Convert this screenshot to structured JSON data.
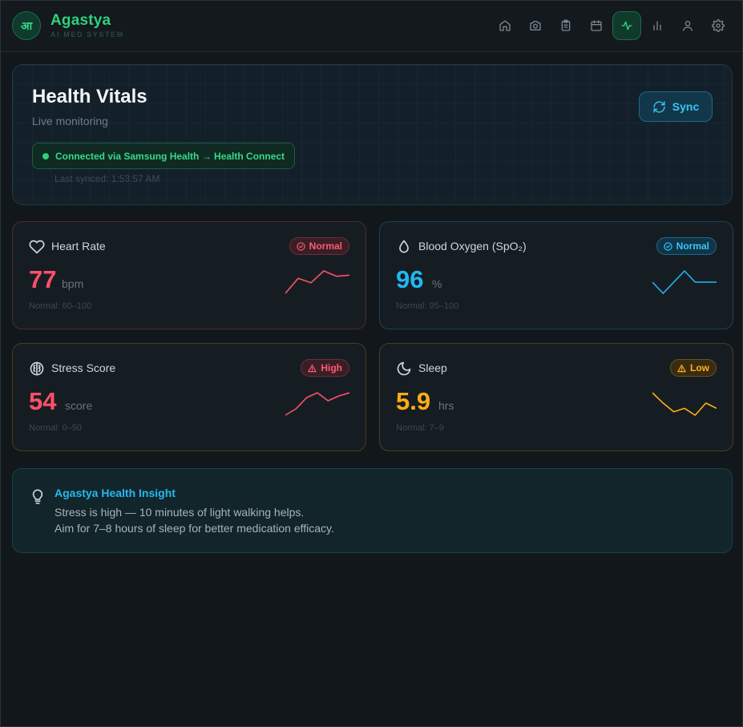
{
  "app": {
    "logo_glyph": "आ",
    "name": "Agastya",
    "tagline": "AI MED SYSTEM"
  },
  "nav": {
    "items": [
      {
        "icon": "home-icon",
        "active": false
      },
      {
        "icon": "camera-icon",
        "active": false
      },
      {
        "icon": "clipboard-icon",
        "active": false
      },
      {
        "icon": "calendar-icon",
        "active": false
      },
      {
        "icon": "activity-icon",
        "active": true
      },
      {
        "icon": "bar-chart-icon",
        "active": false
      },
      {
        "icon": "user-icon",
        "active": false
      },
      {
        "icon": "gear-icon",
        "active": false
      }
    ]
  },
  "vitals_panel": {
    "title": "Health Vitals",
    "subtitle": "Live monitoring",
    "connection": "Connected via Samsung Health → Health Connect",
    "last_synced": "Last synced: 1:53:57 AM",
    "sync_label": "Sync"
  },
  "cards": {
    "heart_rate": {
      "title": "Heart Rate",
      "icon": "heart-icon",
      "status": "Normal",
      "value": "77",
      "unit": "bpm",
      "normal_range": "Normal: 60–100",
      "color": "#ff4f6a",
      "trend": [
        58,
        72,
        68,
        79,
        74,
        75
      ]
    },
    "spo2": {
      "title": "Blood Oxygen (SpO₂)",
      "icon": "droplet-icon",
      "status": "Normal",
      "value": "96",
      "unit": "%",
      "normal_range": "Normal: 95–100",
      "color": "#1fb8f2",
      "trend": [
        95,
        92,
        95,
        98,
        95,
        95,
        95
      ]
    },
    "stress": {
      "title": "Stress Score",
      "icon": "brain-icon",
      "status": "High",
      "value": "54",
      "unit": "score",
      "normal_range": "Normal: 0–50",
      "color": "#ff4f6a",
      "trend": [
        40,
        44,
        51,
        54,
        49,
        52,
        54
      ]
    },
    "sleep": {
      "title": "Sleep",
      "icon": "moon-icon",
      "status": "Low",
      "value": "5.9",
      "unit": "hrs",
      "normal_range": "Normal: 7–9",
      "color": "#ffad14",
      "trend": [
        7.2,
        6.6,
        6.1,
        6.3,
        5.9,
        6.6,
        6.3
      ]
    }
  },
  "insight": {
    "title": "Agastya Health Insight",
    "line1": "Stress is high — 10 minutes of light walking helps.",
    "line2": "Aim for 7–8 hours of sleep for better medication efficacy."
  }
}
